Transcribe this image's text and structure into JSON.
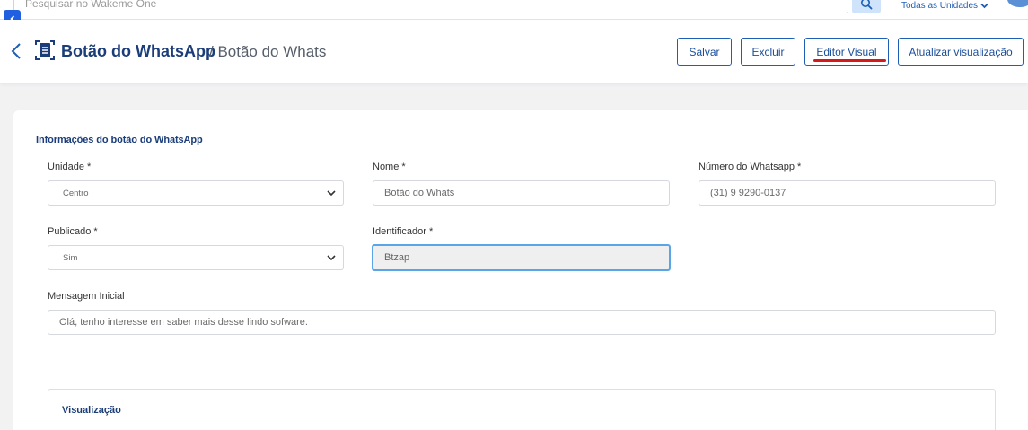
{
  "topbar": {
    "search_placeholder": "Pesquisar no Wakeme One",
    "units_label": "Todas as Unidades"
  },
  "header": {
    "title": "Botão do WhatsApp",
    "subtitle": "/ Botão do Whats",
    "buttons": {
      "save": "Salvar",
      "delete": "Excluir",
      "visual_editor": "Editor Visual",
      "refresh_preview": "Atualizar visualização"
    }
  },
  "form": {
    "section_title": "Informações do botão do WhatsApp",
    "unidade": {
      "label": "Unidade *",
      "value": "Centro"
    },
    "nome": {
      "label": "Nome *",
      "value": "Botão do Whats"
    },
    "numero": {
      "label": "Número do Whatsapp *",
      "value": "(31) 9 9290-0137"
    },
    "publicado": {
      "label": "Publicado *",
      "value": "Sim"
    },
    "identificador": {
      "label": "Identificador *",
      "value": "Btzap"
    },
    "mensagem": {
      "label": "Mensagem Inicial",
      "value": "Olá, tenho interesse em saber mais desse lindo sofware."
    }
  },
  "preview": {
    "title": "Visualização"
  },
  "colors": {
    "brand": "#1b3d7a",
    "accent": "#1f5eb5",
    "highlight_mark": "#d61a1a"
  }
}
